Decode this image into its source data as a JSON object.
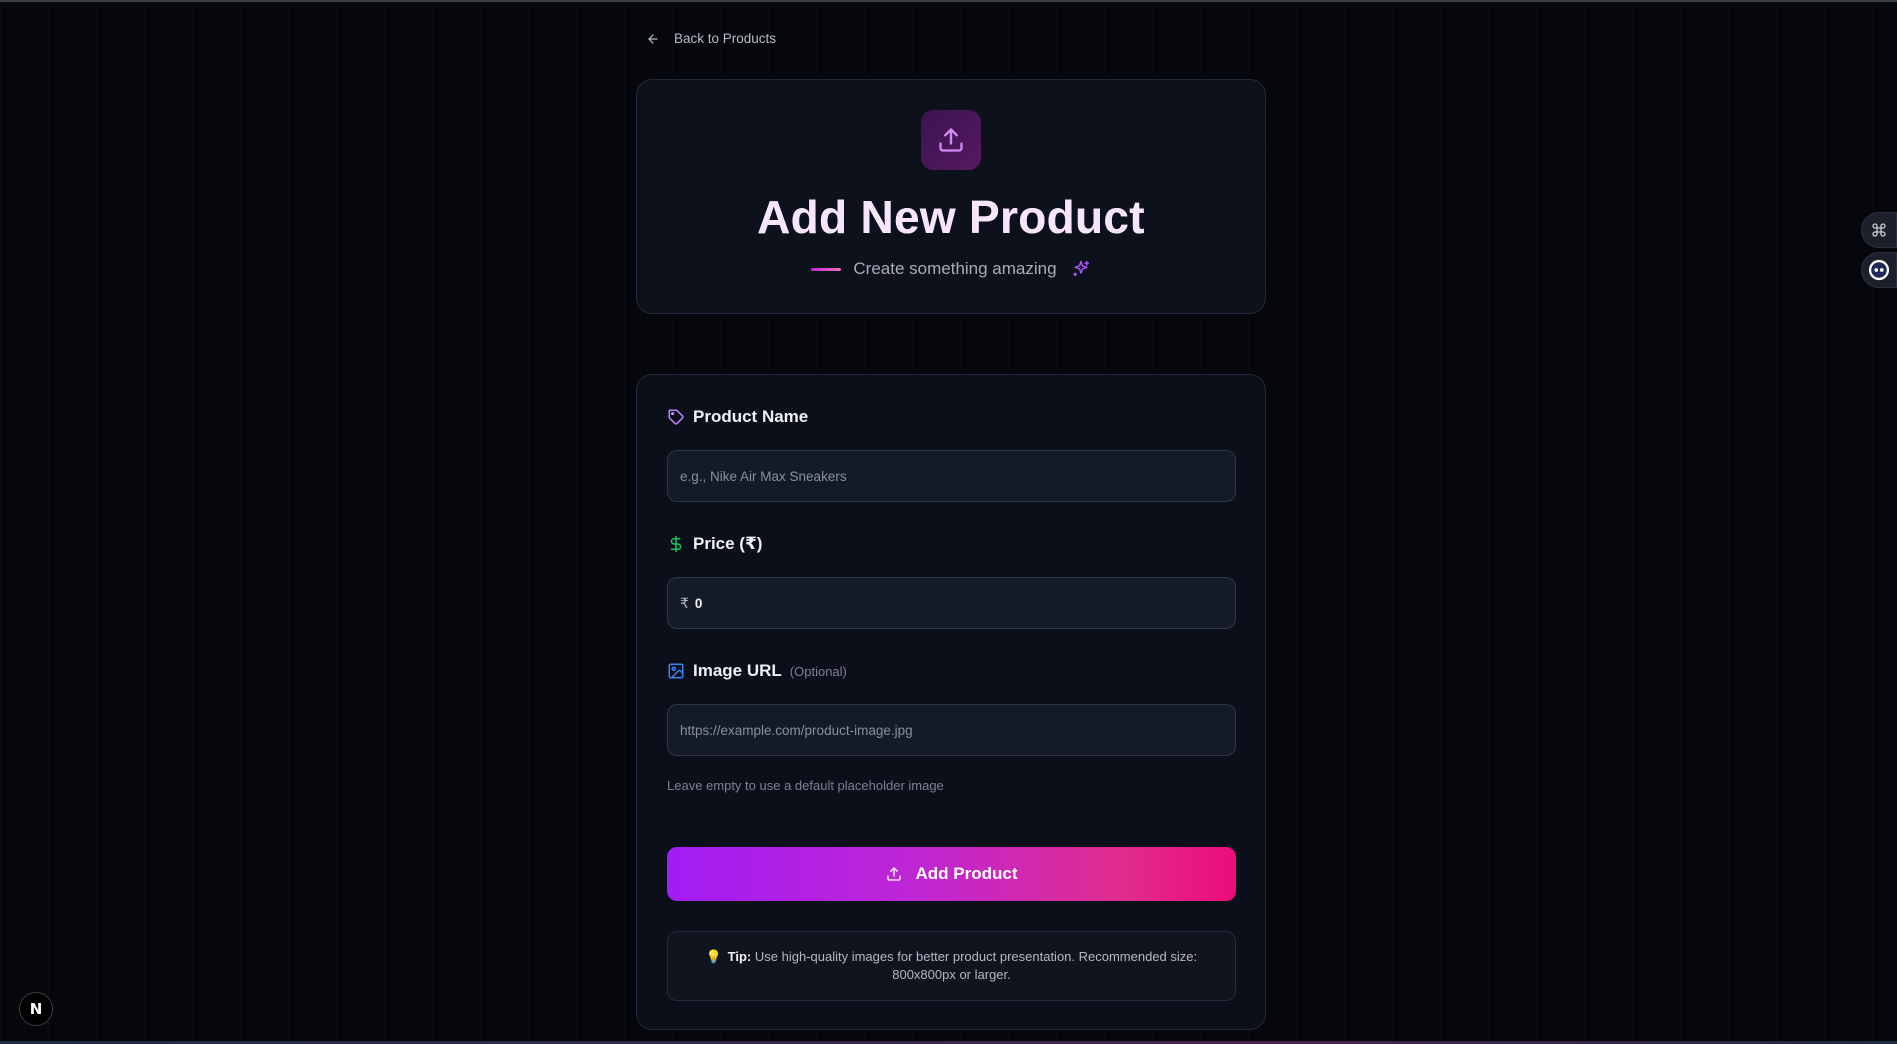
{
  "nav": {
    "back_label": "Back to Products"
  },
  "header": {
    "title": "Add New Product",
    "subtitle": "Create something amazing",
    "icon": "upload-icon"
  },
  "form": {
    "product_name": {
      "label": "Product Name",
      "icon": "tag-icon",
      "placeholder": "e.g., Nike Air Max Sneakers",
      "value": ""
    },
    "price": {
      "label": "Price (₹)",
      "icon": "dollar-icon",
      "prefix": "₹",
      "value": "0"
    },
    "image_url": {
      "label": "Image URL",
      "optional": "(Optional)",
      "icon": "image-icon",
      "placeholder": "https://example.com/product-image.jpg",
      "value": "",
      "hint": "Leave empty to use a default placeholder image"
    },
    "submit_label": "Add Product",
    "tip": {
      "bulb": "💡",
      "title": "Tip:",
      "text": "Use high-quality images for better product presentation. Recommended size: 800x800px or larger."
    }
  },
  "colors": {
    "background": "#05070d",
    "card": "#0b0f1a",
    "accent_start": "#a21cf4",
    "accent_end": "#ec0c7c",
    "tag_icon": "#c084fc",
    "price_icon": "#22c55e",
    "image_icon": "#3b82f6"
  },
  "floating": {
    "next_badge": "N"
  }
}
